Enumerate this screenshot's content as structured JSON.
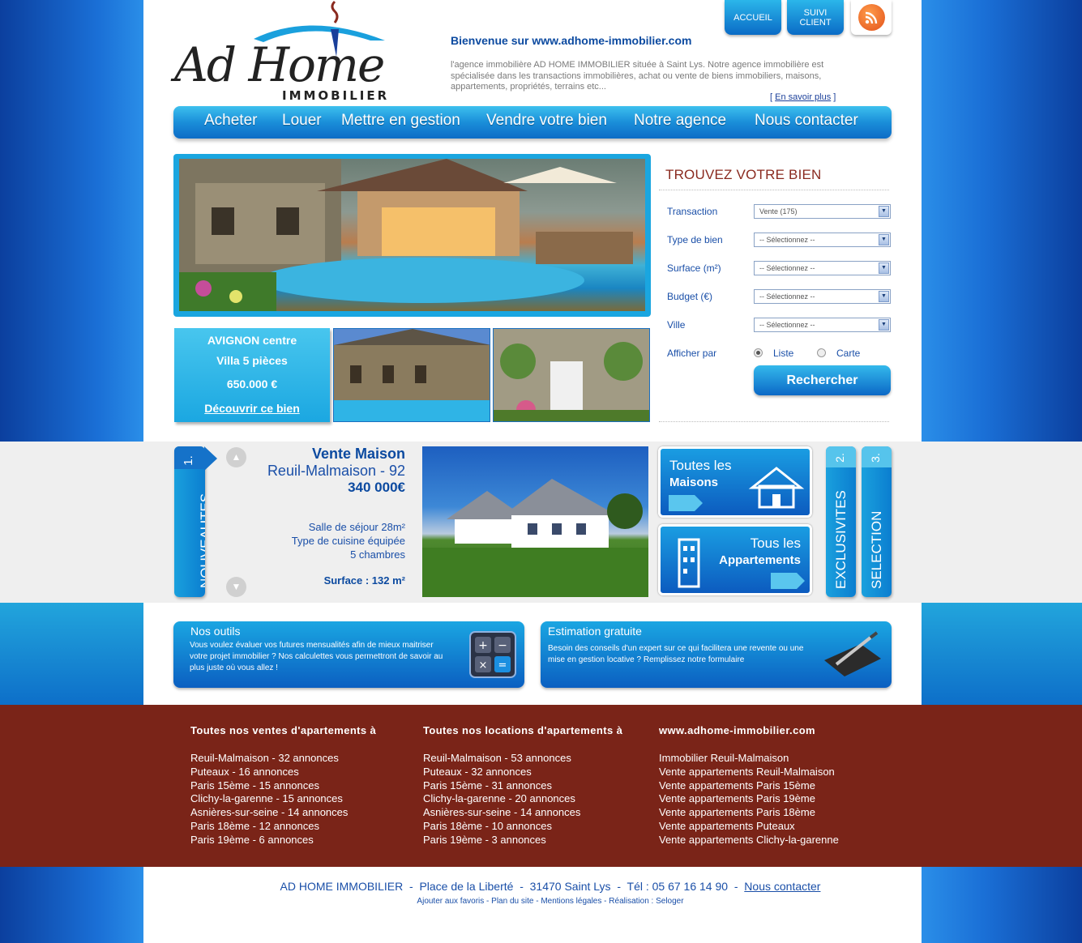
{
  "header": {
    "logo_name": "Ad Home",
    "logo_sub": "IMMOBILIER",
    "welcome_title": "Bienvenue sur www.adhome-immobilier.com",
    "welcome_text": "l'agence immobilière AD HOME IMMOBILIER située à Saint Lys. Notre agence immobilière est spécialisée dans les transactions immobilières, achat ou vente de biens immobiliers, maisons, appartements, propriétés, terrains etc...",
    "learn_more_open": "[",
    "learn_more": "En savoir plus",
    "learn_more_close": "]",
    "top_buttons": {
      "home": "ACCUEIL",
      "client_1": "SUIVI",
      "client_2": "CLIENT"
    },
    "rss_icon": "rss-icon"
  },
  "nav": [
    "Acheter",
    "Louer",
    "Mettre en gestion",
    "Vendre votre bien",
    "Notre agence",
    "Nous contacter"
  ],
  "promo": {
    "location": "AVIGNON centre",
    "type": "Villa 5 pièces",
    "price": "650.000 €",
    "link": "Découvrir ce bien"
  },
  "search": {
    "title": "TROUVEZ VOTRE BIEN",
    "fields": [
      {
        "label": "Transaction",
        "value": "Vente (175)"
      },
      {
        "label": "Type de bien",
        "value": "-- Sélectionnez --"
      },
      {
        "label": "Surface (m²)",
        "value": "-- Sélectionnez --"
      },
      {
        "label": "Budget (€)",
        "value": "-- Sélectionnez --"
      },
      {
        "label": "Ville",
        "value": "-- Sélectionnez --"
      }
    ],
    "display_label": "Afficher par",
    "display_options": [
      "Liste",
      "Carte"
    ],
    "display_selected": "Liste",
    "submit": "Rechercher"
  },
  "tabs": {
    "new": {
      "num": "1.",
      "label": "NOUVEAUTES"
    },
    "excl": {
      "num": "2.",
      "label": "EXCLUSIVITES"
    },
    "sel": {
      "num": "3.",
      "label": "SELECTION"
    }
  },
  "listing": {
    "title": "Vente Maison",
    "city": "Reuil-Malmaison - 92",
    "price": "340 000€",
    "features": [
      "Salle de séjour 28m²",
      "Type de cuisine équipée",
      "5 chambres"
    ],
    "surface": "Surface : 132 m²"
  },
  "categories": {
    "houses_1": "Toutes les",
    "houses_2": "Maisons",
    "apts_1": "Tous les",
    "apts_2": "Appartements"
  },
  "tools": {
    "outils_title": "Nos outils",
    "outils_text": "Vous voulez évaluer vos futures mensualités afin de mieux maitriser votre projet immobilier ? Nos calculettes vous permettront de savoir au plus juste où vous allez !",
    "estim_title": "Estimation gratuite",
    "estim_text": "Besoin des conseils d'un expert sur ce qui facilitera une revente ou une mise en gestion locative ? Remplissez notre formulaire"
  },
  "footer_cols": [
    {
      "title": "Toutes nos ventes d'apartements à",
      "items": [
        "Reuil-Malmaison - 32 annonces",
        "Puteaux - 16 annonces",
        "Paris 15ème - 15 annonces",
        "Clichy-la-garenne - 15 annonces",
        "Asnières-sur-seine - 14 annonces",
        "Paris 18ème - 12 annonces",
        "Paris 19ème - 6 annonces"
      ]
    },
    {
      "title": "Toutes nos locations d'apartements à",
      "items": [
        "Reuil-Malmaison - 53 annonces",
        "Puteaux - 32 annonces",
        "Paris 15ème - 31 annonces",
        "Clichy-la-garenne - 20 annonces",
        "Asnières-sur-seine - 14 annonces",
        "Paris 18ème - 10 annonces",
        "Paris 19ème - 3 annonces"
      ]
    },
    {
      "title": "www.adhome-immobilier.com",
      "items": [
        "Immobilier Reuil-Malmaison",
        "Vente appartements Reuil-Malmaison",
        "Vente appartements Paris 15ème",
        "Vente appartements Paris 19ème",
        "Vente appartements Paris 18ème",
        "Vente appartements Puteaux",
        "Vente appartements Clichy-la-garenne"
      ]
    }
  ],
  "footer": {
    "company": "AD HOME IMMOBILIER",
    "address": "Place de la Liberté",
    "city": "31470 Saint Lys",
    "phone": "Tél : 05 67 16 14 90",
    "contact": "Nous contacter",
    "sep": "-",
    "links": [
      "Ajouter aux favoris",
      "Plan du site",
      "Mentions légales",
      "Réalisation : Seloger"
    ]
  },
  "colors": {
    "brand_blue": "#1a8ed9",
    "dark_blue": "#0c4aa0",
    "brown": "#7a2418",
    "title_red": "#8a2a1f"
  }
}
